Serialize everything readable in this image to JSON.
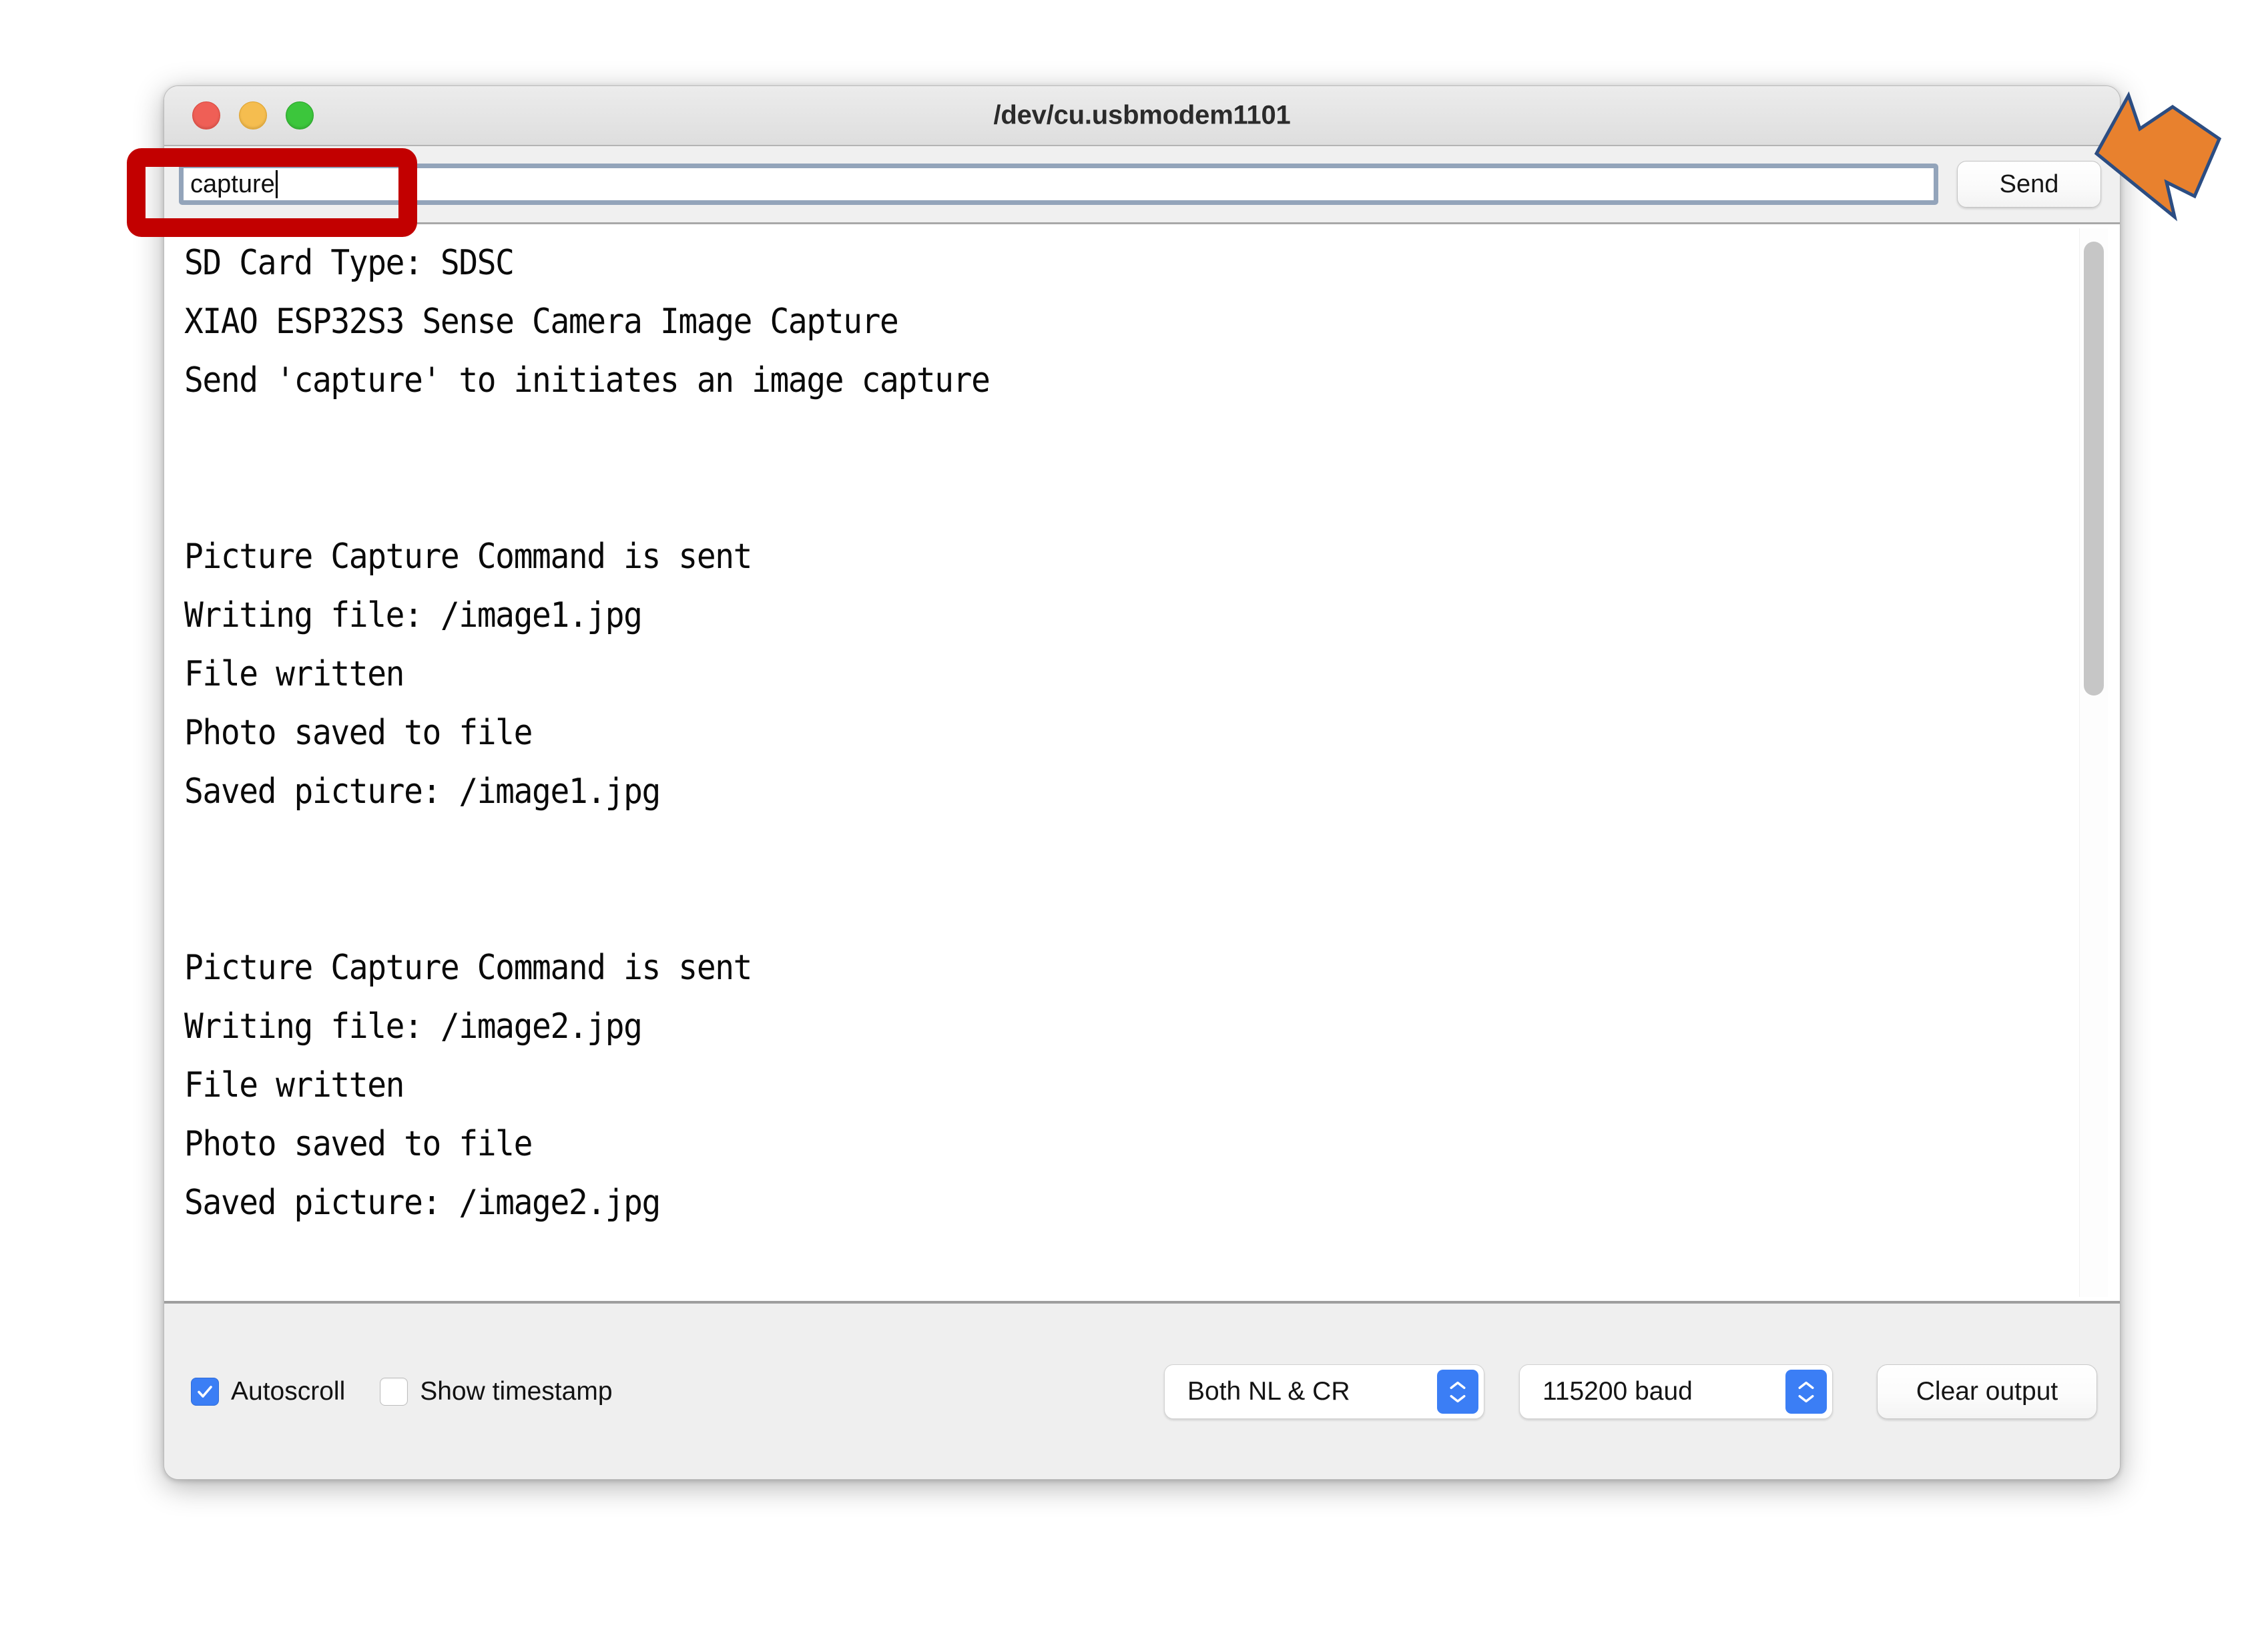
{
  "window": {
    "title": "/dev/cu.usbmodem1101",
    "traffic_lights": [
      "close",
      "minimize",
      "zoom"
    ],
    "colors": {
      "close": "#ef5f56",
      "minimize": "#f5bd4f",
      "zoom": "#3cc63c"
    }
  },
  "send_bar": {
    "input_value": "capture",
    "input_placeholder": "",
    "send_label": "Send"
  },
  "console": {
    "lines": [
      "SD Card Type: SDSC",
      "XIAO ESP32S3 Sense Camera Image Capture",
      "Send 'capture' to initiates an image capture",
      "",
      "",
      "Picture Capture Command is sent",
      "Writing file: /image1.jpg",
      "File written",
      "Photo saved to file",
      "Saved picture: /image1.jpg",
      "",
      "",
      "Picture Capture Command is sent",
      "Writing file: /image2.jpg",
      "File written",
      "Photo saved to file",
      "Saved picture: /image2.jpg"
    ],
    "text": "SD Card Type: SDSC\nXIAO ESP32S3 Sense Camera Image Capture\nSend 'capture' to initiates an image capture\n\n\nPicture Capture Command is sent\nWriting file: /image1.jpg\nFile written\nPhoto saved to file\nSaved picture: /image1.jpg\n\n\nPicture Capture Command is sent\nWriting file: /image2.jpg\nFile written\nPhoto saved to file\nSaved picture: /image2.jpg"
  },
  "bottom_bar": {
    "autoscroll_label": "Autoscroll",
    "autoscroll_checked": true,
    "show_timestamp_label": "Show timestamp",
    "show_timestamp_checked": false,
    "line_ending_value": "Both NL & CR",
    "baud_value": "115200 baud",
    "clear_output_label": "Clear output",
    "accent_color": "#3b7ef5"
  },
  "annotations": {
    "highlight_color": "#c20000",
    "arrow_fill": "#e8812e",
    "arrow_stroke": "#2c4d82"
  }
}
